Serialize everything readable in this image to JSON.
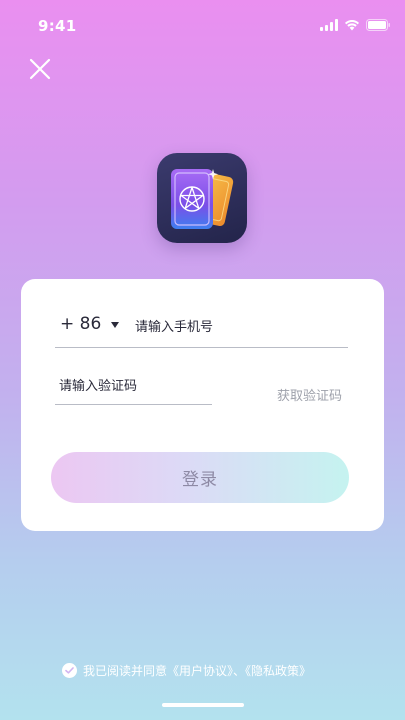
{
  "status_bar": {
    "time": "9:41",
    "icons": [
      "signal-icon",
      "wifi-icon",
      "battery-icon"
    ]
  },
  "header": {
    "close_icon": "close-icon"
  },
  "app_icon": {
    "name": "app-logo-icon",
    "colors": {
      "background": "#2b2c55",
      "card_front": "#8a5cf0",
      "card_back": "#f2a93b"
    }
  },
  "login_form": {
    "country_code": "+ 86",
    "phone_placeholder": "请输入手机号",
    "code_placeholder": "请输入验证码",
    "get_code_label": "获取验证码",
    "login_label": "登录"
  },
  "agreement": {
    "prefix": "我已阅读并同意",
    "user_agreement": "《用户协议》",
    "separator": "、",
    "privacy_policy": "《隐私政策》"
  },
  "colors": {
    "gradient_top": "#ea8ff0",
    "gradient_bottom": "#b3e2ee",
    "login_button_start": "#ecc7f2",
    "login_button_end": "#c5f3f0"
  }
}
